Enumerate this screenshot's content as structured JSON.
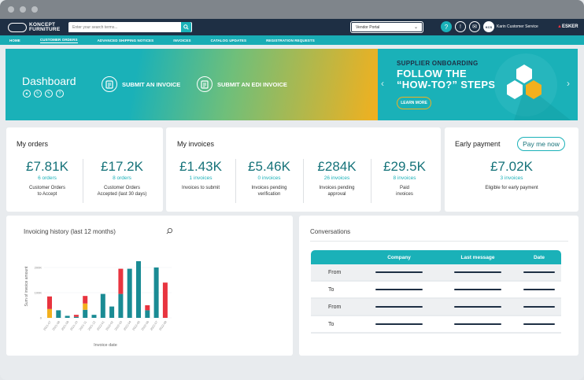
{
  "header": {
    "logo_line1": "KONCEPT",
    "logo_line2": "FURNITURE",
    "search_placeholder": "Enter your search terms...",
    "portal_select": "Vendor Portal",
    "user_name": "Karin Customer Service",
    "user_initials": "KCS",
    "brand": "ESKER"
  },
  "nav": {
    "items": [
      "HOME",
      "CUSTOMER ORDERS",
      "ADVANCED SHIPPING NOTICES",
      "INVOICES",
      "CATALOG UPDATES",
      "REGISTRATION REQUESTS"
    ]
  },
  "hero": {
    "title": "Dashboard",
    "action1": "SUBMIT AN INVOICE",
    "action2": "SUBMIT AN EDI INVOICE",
    "promo_line1": "SUPPLIER ONBOARDING",
    "promo_line2": "FOLLOW THE",
    "promo_line3": "“HOW-TO?” STEPS",
    "promo_button": "LEARN MORE"
  },
  "my_orders": {
    "title": "My orders",
    "metrics": [
      {
        "value": "£7.81K",
        "count": "6 orders",
        "desc1": "Customer Orders",
        "desc2": "to Accept"
      },
      {
        "value": "£17.2K",
        "count": "8 orders",
        "desc1": "Customer Orders",
        "desc2": "Accepted (last 30 days)"
      }
    ]
  },
  "my_invoices": {
    "title": "My invoices",
    "metrics": [
      {
        "value": "£1.43K",
        "count": "1 invoices",
        "desc1": "Invoices to submit",
        "desc2": ""
      },
      {
        "value": "£5.46K",
        "count": "0 invoices",
        "desc1": "Invoices pending",
        "desc2": "verification"
      },
      {
        "value": "£284K",
        "count": "26 invoices",
        "desc1": "Invoices pending",
        "desc2": "approval"
      },
      {
        "value": "£29.5K",
        "count": "8 invoices",
        "desc1": "Paid",
        "desc2": "invoices"
      }
    ]
  },
  "early_payment": {
    "title": "Early payment",
    "button": "Pay me now",
    "value": "£7.02K",
    "count": "3 invoices",
    "desc": "Eligible for early payment"
  },
  "chart_data": {
    "type": "bar",
    "title": "Invoicing history (last 12 months)",
    "xlabel": "Invoice date",
    "ylabel": "Sum of invoice amount",
    "yticks": [
      "0",
      "100K",
      "200K"
    ],
    "ylim": [
      0,
      250000
    ],
    "categories": [
      "2021-07",
      "2021-08",
      "2021-09",
      "2021-10",
      "2021-11",
      "2021-12",
      "2022-01",
      "2022-02",
      "2022-03",
      "2022-04",
      "2022-05",
      "2022-06",
      "2022-07",
      "2022-08"
    ],
    "series": [
      {
        "color": "#1a8b94",
        "values": [
          0,
          30000,
          8000,
          4000,
          32000,
          12000,
          95000,
          45000,
          95000,
          195000,
          225000,
          30000,
          200000,
          0
        ]
      },
      {
        "color": "#f2b01e",
        "values": [
          35000,
          0,
          0,
          0,
          25000,
          0,
          0,
          0,
          0,
          0,
          0,
          0,
          0,
          0
        ]
      },
      {
        "color": "#e8343f",
        "values": [
          50000,
          0,
          0,
          8000,
          30000,
          0,
          0,
          0,
          100000,
          0,
          0,
          20000,
          0,
          140000
        ]
      }
    ]
  },
  "conversations": {
    "title": "Conversations",
    "columns": [
      "Company",
      "Last message",
      "Date"
    ],
    "rows": [
      {
        "label": "From"
      },
      {
        "label": "To"
      },
      {
        "label": "From"
      },
      {
        "label": "To"
      }
    ]
  }
}
